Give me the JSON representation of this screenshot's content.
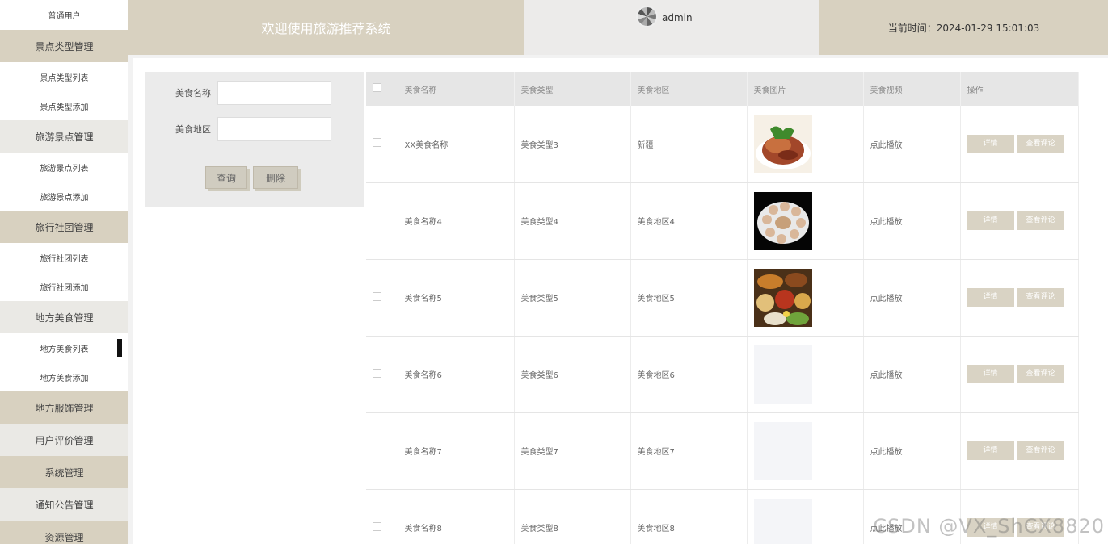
{
  "sidebar": {
    "user_role": "普通用户",
    "items": [
      {
        "label": "景点类型管理",
        "kind": "group",
        "tone": "dark"
      },
      {
        "label": "景点类型列表",
        "kind": "item"
      },
      {
        "label": "景点类型添加",
        "kind": "item"
      },
      {
        "label": "旅游景点管理",
        "kind": "group",
        "tone": "light"
      },
      {
        "label": "旅游景点列表",
        "kind": "item"
      },
      {
        "label": "旅游景点添加",
        "kind": "item"
      },
      {
        "label": "旅行社团管理",
        "kind": "group",
        "tone": "dark"
      },
      {
        "label": "旅行社团列表",
        "kind": "item"
      },
      {
        "label": "旅行社团添加",
        "kind": "item"
      },
      {
        "label": "地方美食管理",
        "kind": "group",
        "tone": "light"
      },
      {
        "label": "地方美食列表",
        "kind": "item",
        "active": true
      },
      {
        "label": "地方美食添加",
        "kind": "item"
      },
      {
        "label": "地方服饰管理",
        "kind": "group",
        "tone": "dark"
      },
      {
        "label": "用户评价管理",
        "kind": "group",
        "tone": "light"
      },
      {
        "label": "系统管理",
        "kind": "group",
        "tone": "dark"
      },
      {
        "label": "通知公告管理",
        "kind": "group",
        "tone": "light"
      },
      {
        "label": "资源管理",
        "kind": "group",
        "tone": "dark"
      }
    ]
  },
  "header": {
    "title": "欢迎使用旅游推荐系统",
    "username": "admin",
    "time": "当前时间：2024-01-29 15:01:03",
    "avatar_icon": "avatar-icon"
  },
  "search": {
    "name_label": "美食名称",
    "name_value": "",
    "region_label": "美食地区",
    "region_value": "",
    "query_button": "查询",
    "delete_button": "删除"
  },
  "table": {
    "columns": [
      "美食名称",
      "美食类型",
      "美食地区",
      "美食图片",
      "美食视频",
      "操作"
    ],
    "rows": [
      {
        "name": "XX美食名称",
        "type": "美食类型3",
        "region": "新疆",
        "image": "roast-duck",
        "video": "点此播放"
      },
      {
        "name": "美食名称4",
        "type": "美食类型4",
        "region": "美食地区4",
        "image": "dumpling-plate",
        "video": "点此播放"
      },
      {
        "name": "美食名称5",
        "type": "美食类型5",
        "region": "美食地区5",
        "image": "food-spread",
        "video": "点此播放"
      },
      {
        "name": "美食名称6",
        "type": "美食类型6",
        "region": "美食地区6",
        "image": "empty",
        "video": "点此播放"
      },
      {
        "name": "美食名称7",
        "type": "美食类型7",
        "region": "美食地区7",
        "image": "empty",
        "video": "点此播放"
      },
      {
        "name": "美食名称8",
        "type": "美食类型8",
        "region": "美食地区8",
        "image": "empty",
        "video": "点此播放"
      }
    ],
    "detail_button": "详情",
    "review_button": "查看评论"
  },
  "watermark": "CSDN @VX_ShCX8820",
  "colors": {
    "sidebar_group_dark": "#d8d1c0",
    "sidebar_group_light": "#eae9e5",
    "header_bg": "#d8d1c0",
    "action_button": "#d9d3c4"
  }
}
